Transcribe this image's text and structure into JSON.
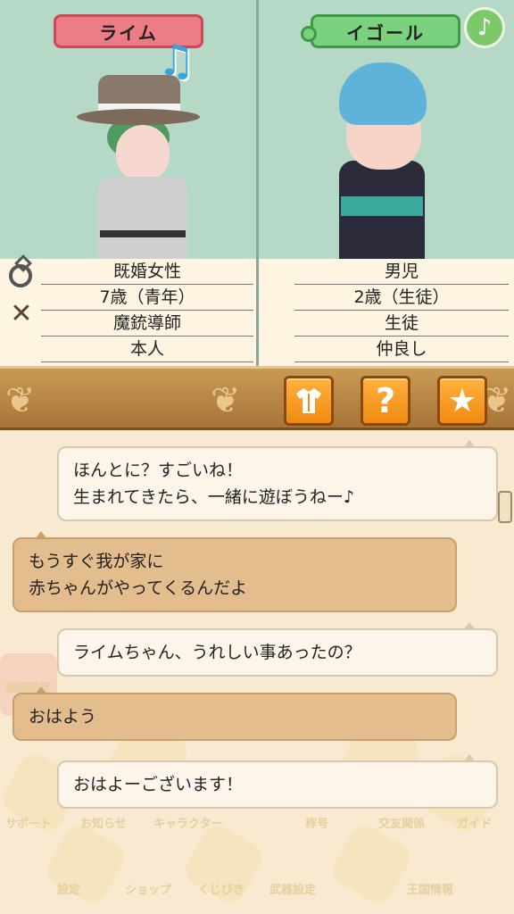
{
  "characters": {
    "left": {
      "name": "ライム",
      "info": [
        "既婚女性",
        "7歳（青年）",
        "魔銃導師",
        "本人"
      ]
    },
    "right": {
      "name": "イゴール",
      "info": [
        "男児",
        "2歳（生徒）",
        "生徒",
        "仲良し"
      ]
    }
  },
  "icons": {
    "music": "music-note-icon",
    "ring": "ring-icon",
    "swords": "crossed-swords-icon",
    "outfit": "outfit-icon",
    "help": "help-icon",
    "favorite": "star-icon"
  },
  "toolbar": {
    "help_glyph": "?",
    "favorite_glyph": "★",
    "music_glyph": "♪"
  },
  "chat": {
    "messages": [
      {
        "side": "right",
        "lines": [
          "ほんとに？すごいね！",
          "生まれてきたら、一緒に遊ぼうねー♪"
        ]
      },
      {
        "side": "left",
        "lines": [
          "もうすぐ我が家に",
          "赤ちゃんがやってくるんだよ"
        ]
      },
      {
        "side": "right",
        "lines": [
          "ライムちゃん、うれしい事あったの？"
        ]
      },
      {
        "side": "left",
        "lines": [
          "おはよう"
        ]
      },
      {
        "side": "right",
        "lines": [
          "おはよーございます！"
        ]
      }
    ]
  },
  "background_menu": {
    "limited_badge": "期間限定",
    "items": [
      "サポート",
      "お知らせ",
      "キャラクター",
      "称号",
      "交友関係",
      "ガイド",
      "設定",
      "ショップ",
      "くじびき",
      "武器設定",
      "王国情報"
    ]
  },
  "colors": {
    "panel_bg": "#b6d8c6",
    "left_tag": "#ec7c86",
    "right_tag": "#7ad17e",
    "toolbar": "#b8854a",
    "button": "#f5a020",
    "bubble_right": "#fdf5ea",
    "bubble_left": "#e4bd8f"
  }
}
